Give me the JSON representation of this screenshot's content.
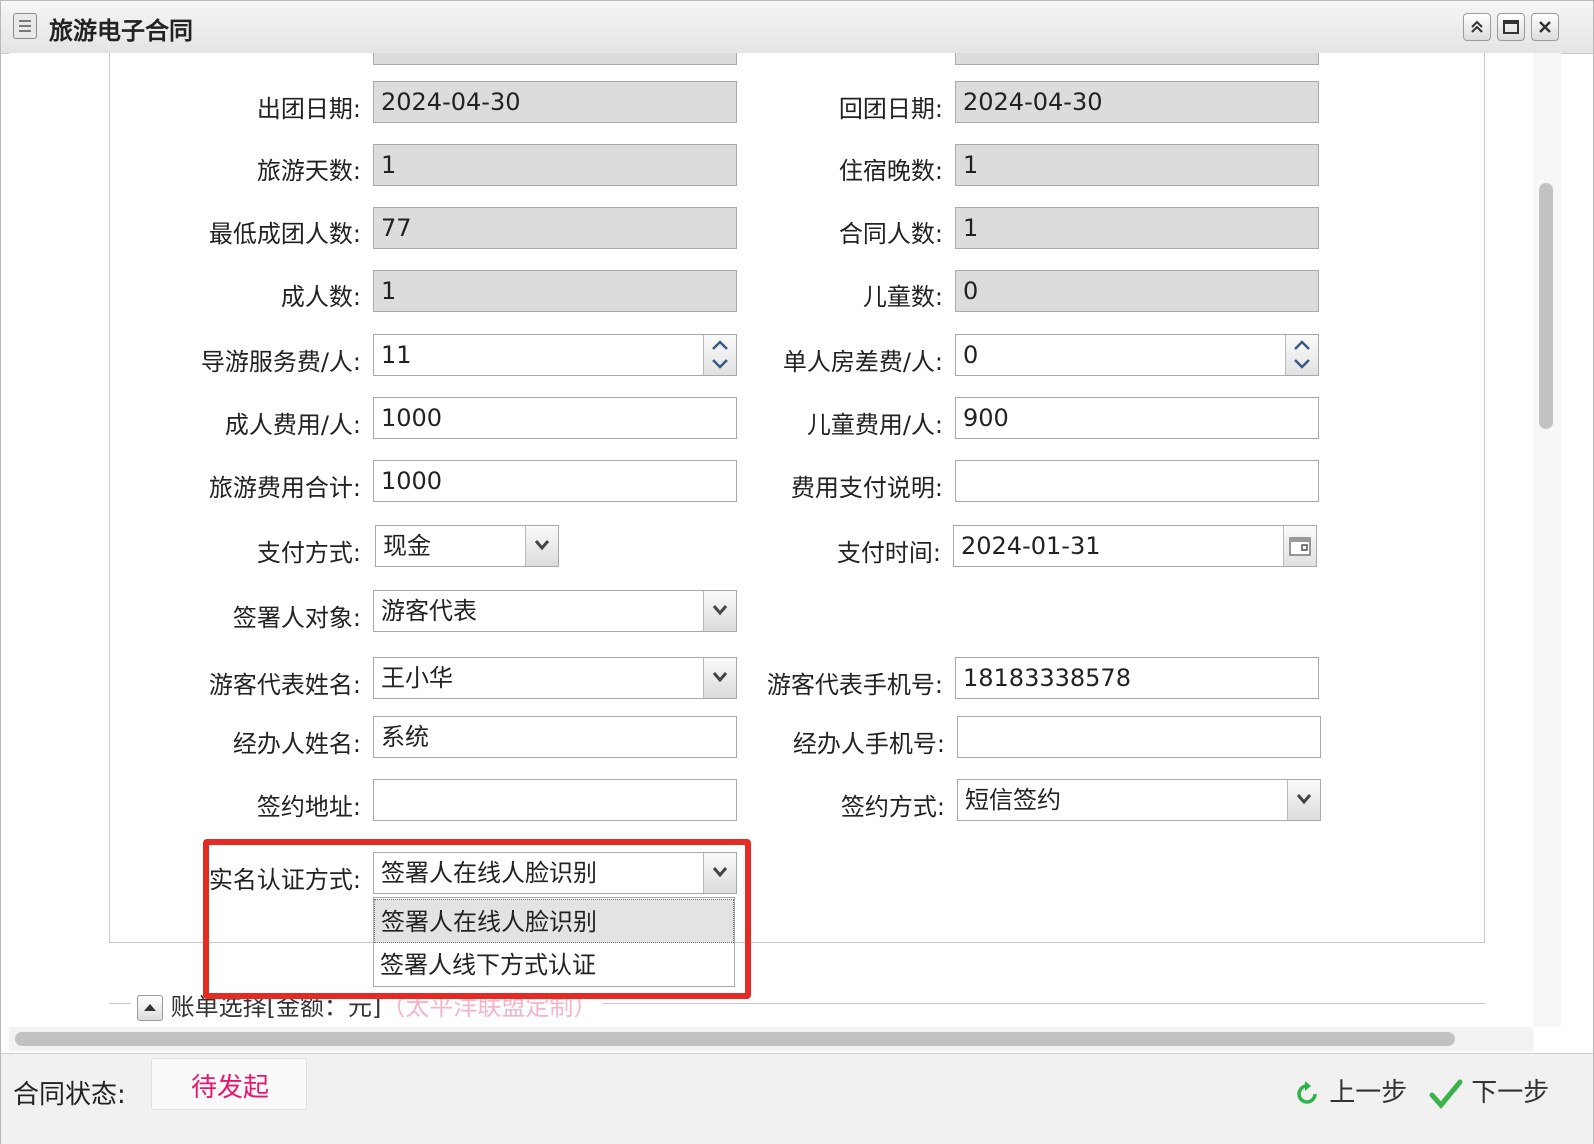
{
  "window": {
    "title": "旅游电子合同"
  },
  "form": {
    "depart_date": {
      "label": "出团日期:",
      "value": "2024-04-30"
    },
    "return_date": {
      "label": "回团日期:",
      "value": "2024-04-30"
    },
    "travel_days": {
      "label": "旅游天数:",
      "value": "1"
    },
    "nights": {
      "label": "住宿晚数:",
      "value": "1"
    },
    "min_group": {
      "label": "最低成团人数:",
      "value": "77"
    },
    "contract_people": {
      "label": "合同人数:",
      "value": "1"
    },
    "adults": {
      "label": "成人数:",
      "value": "1"
    },
    "children": {
      "label": "儿童数:",
      "value": "0"
    },
    "guide_fee": {
      "label": "导游服务费/人:",
      "value": "11"
    },
    "single_room_fee": {
      "label": "单人房差费/人:",
      "value": "0"
    },
    "adult_fee": {
      "label": "成人费用/人:",
      "value": "1000"
    },
    "child_fee": {
      "label": "儿童费用/人:",
      "value": "900"
    },
    "total_fee": {
      "label": "旅游费用合计:",
      "value": "1000"
    },
    "payment_note": {
      "label": "费用支付说明:",
      "value": ""
    },
    "payment_method": {
      "label": "支付方式:",
      "value": "现金"
    },
    "payment_time": {
      "label": "支付时间:",
      "value": "2024-01-31"
    },
    "signer_object": {
      "label": "签署人对象:",
      "value": "游客代表"
    },
    "rep_name": {
      "label": "游客代表姓名:",
      "value": "王小华"
    },
    "rep_phone": {
      "label": "游客代表手机号:",
      "value": "18183338578"
    },
    "agent_name": {
      "label": "经办人姓名:",
      "value": "系统"
    },
    "agent_phone": {
      "label": "经办人手机号:",
      "value": ""
    },
    "sign_address": {
      "label": "签约地址:",
      "value": ""
    },
    "sign_method": {
      "label": "签约方式:",
      "value": "短信签约"
    },
    "auth_method": {
      "label": "实名认证方式:",
      "value": "签署人在线人脸识别",
      "options": [
        "签署人在线人脸识别",
        "签署人线下方式认证"
      ],
      "selected_index": 0
    }
  },
  "bill_section": {
    "legend": "账单选择[金额：元]",
    "note": "（太平洋联盟定制）"
  },
  "status_bar": {
    "label": "合同状态:",
    "value": "待发起",
    "prev_label": "上一步",
    "next_label": "下一步"
  },
  "colors": {
    "status": "#e8166d",
    "highlight": "#e32b24",
    "readonly_bg": "#dcdcdc"
  },
  "icons": [
    "list-icon",
    "collapse-icon",
    "maximize-icon",
    "close-icon",
    "spinner-up-icon",
    "spinner-down-icon",
    "chevron-down-icon",
    "calendar-icon",
    "refresh-icon",
    "checkmark-icon"
  ]
}
